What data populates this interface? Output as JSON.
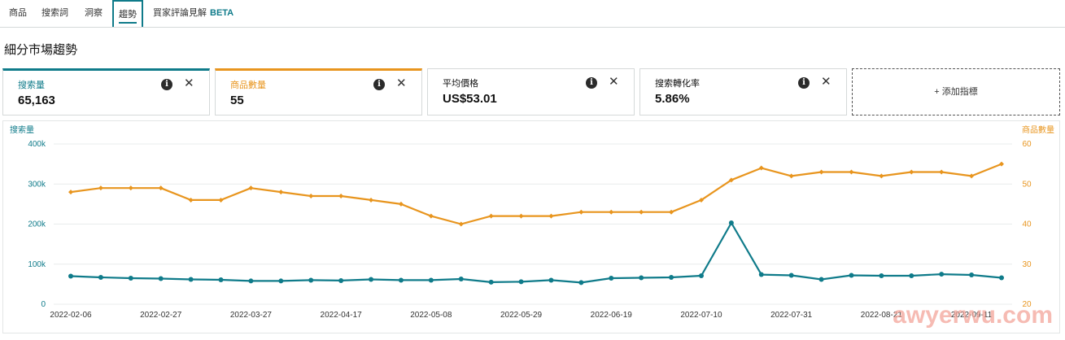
{
  "tabs": [
    {
      "label": "商品"
    },
    {
      "label": "搜索詞"
    },
    {
      "label": "洞察"
    },
    {
      "label": "趨勢"
    },
    {
      "label": "買家評論見解",
      "badge": "BETA"
    }
  ],
  "section_title": "細分市場趨勢",
  "metric_cards": [
    {
      "label": "搜索量",
      "value": "65,163",
      "color": "#0f7b8a"
    },
    {
      "label": "商品數量",
      "value": "55",
      "color": "#e8951e"
    },
    {
      "label": "平均價格",
      "value": "US$53.01",
      "color": "#111111"
    },
    {
      "label": "搜索轉化率",
      "value": "5.86%",
      "color": "#111111"
    }
  ],
  "add_metric_label": "+ 添加指標",
  "watermark": "awyerwu.com",
  "chart_data": {
    "type": "line",
    "left_axis_label": "搜索量",
    "right_axis_label": "商品數量",
    "left_ylim": [
      0,
      400000
    ],
    "right_ylim": [
      20,
      60
    ],
    "left_ticks": [
      {
        "v": 0,
        "label": "0"
      },
      {
        "v": 100000,
        "label": "100k"
      },
      {
        "v": 200000,
        "label": "200k"
      },
      {
        "v": 300000,
        "label": "300k"
      },
      {
        "v": 400000,
        "label": "400k"
      }
    ],
    "right_ticks": [
      {
        "v": 20,
        "label": "20"
      },
      {
        "v": 30,
        "label": "30"
      },
      {
        "v": 40,
        "label": "40"
      },
      {
        "v": 50,
        "label": "50"
      },
      {
        "v": 60,
        "label": "60"
      }
    ],
    "x_tick_labels": [
      "2022-02-06",
      "2022-02-27",
      "2022-03-27",
      "2022-04-17",
      "2022-05-08",
      "2022-05-29",
      "2022-06-19",
      "2022-07-10",
      "2022-07-31",
      "2022-08-21",
      "2022-09-11"
    ],
    "x_tick_positions": [
      0,
      3,
      6,
      9,
      12,
      15,
      18,
      21,
      24,
      27,
      30
    ],
    "grid": true,
    "series": [
      {
        "name": "搜索量",
        "axis": "left",
        "color": "#0f7b8a",
        "values": [
          70000,
          67000,
          65000,
          64000,
          62000,
          61000,
          58000,
          58000,
          60000,
          59000,
          62000,
          60000,
          60000,
          63000,
          55000,
          56000,
          60000,
          54000,
          65000,
          66000,
          67000,
          71000,
          203000,
          74000,
          72000,
          62000,
          72000,
          71000,
          71000,
          75000,
          73000,
          66000
        ]
      },
      {
        "name": "商品數量",
        "axis": "right",
        "color": "#e8951e",
        "values": [
          48,
          49,
          49,
          49,
          46,
          46,
          49,
          48,
          47,
          47,
          46,
          45,
          42,
          40,
          42,
          42,
          42,
          43,
          43,
          43,
          43,
          46,
          51,
          54,
          52,
          53,
          53,
          52,
          53,
          53,
          52,
          55
        ]
      }
    ]
  }
}
